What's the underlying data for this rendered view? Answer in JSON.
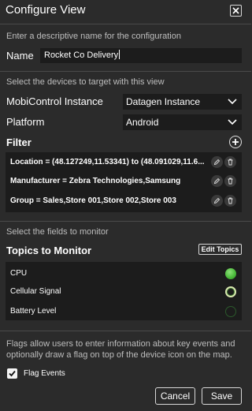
{
  "window": {
    "title": "Configure View"
  },
  "name_section": {
    "hint": "Enter a descriptive name for the configuration",
    "label": "Name",
    "value": "Rocket Co Delivery"
  },
  "devices_section": {
    "hint": "Select the devices to target with this view",
    "instance_label": "MobiControl Instance",
    "instance_value": "Datagen Instance",
    "platform_label": "Platform",
    "platform_value": "Android",
    "filter_label": "Filter",
    "filters": [
      {
        "text": "Location = (48.127249,11.53341) to (48.091029,11.6..."
      },
      {
        "text": "Manufacturer = Zebra Technologies,Samsung"
      },
      {
        "text": "Group = Sales,Store 001,Store 002,Store 003"
      }
    ]
  },
  "fields_section": {
    "hint": "Select the fields to monitor",
    "topics_label": "Topics to Monitor",
    "edit_topics_label": "Edit Topics",
    "topics": [
      {
        "label": "CPU",
        "status": "active"
      },
      {
        "label": "Cellular Signal",
        "status": "warning"
      },
      {
        "label": "Battery Level",
        "status": "off"
      }
    ]
  },
  "flags_section": {
    "description": "Flags allow users to enter information about key events and optionally draw a flag on top of the device icon on the map.",
    "checkbox_label": "Flag Events",
    "checked": true
  },
  "footer": {
    "cancel_label": "Cancel",
    "save_label": "Save"
  },
  "colors": {
    "background": "#2b2b2b",
    "panel": "#1c1c1c",
    "status_active": "#4cbb3c",
    "status_warning": "#d8e8b0",
    "status_off": "#2c5a2c"
  }
}
